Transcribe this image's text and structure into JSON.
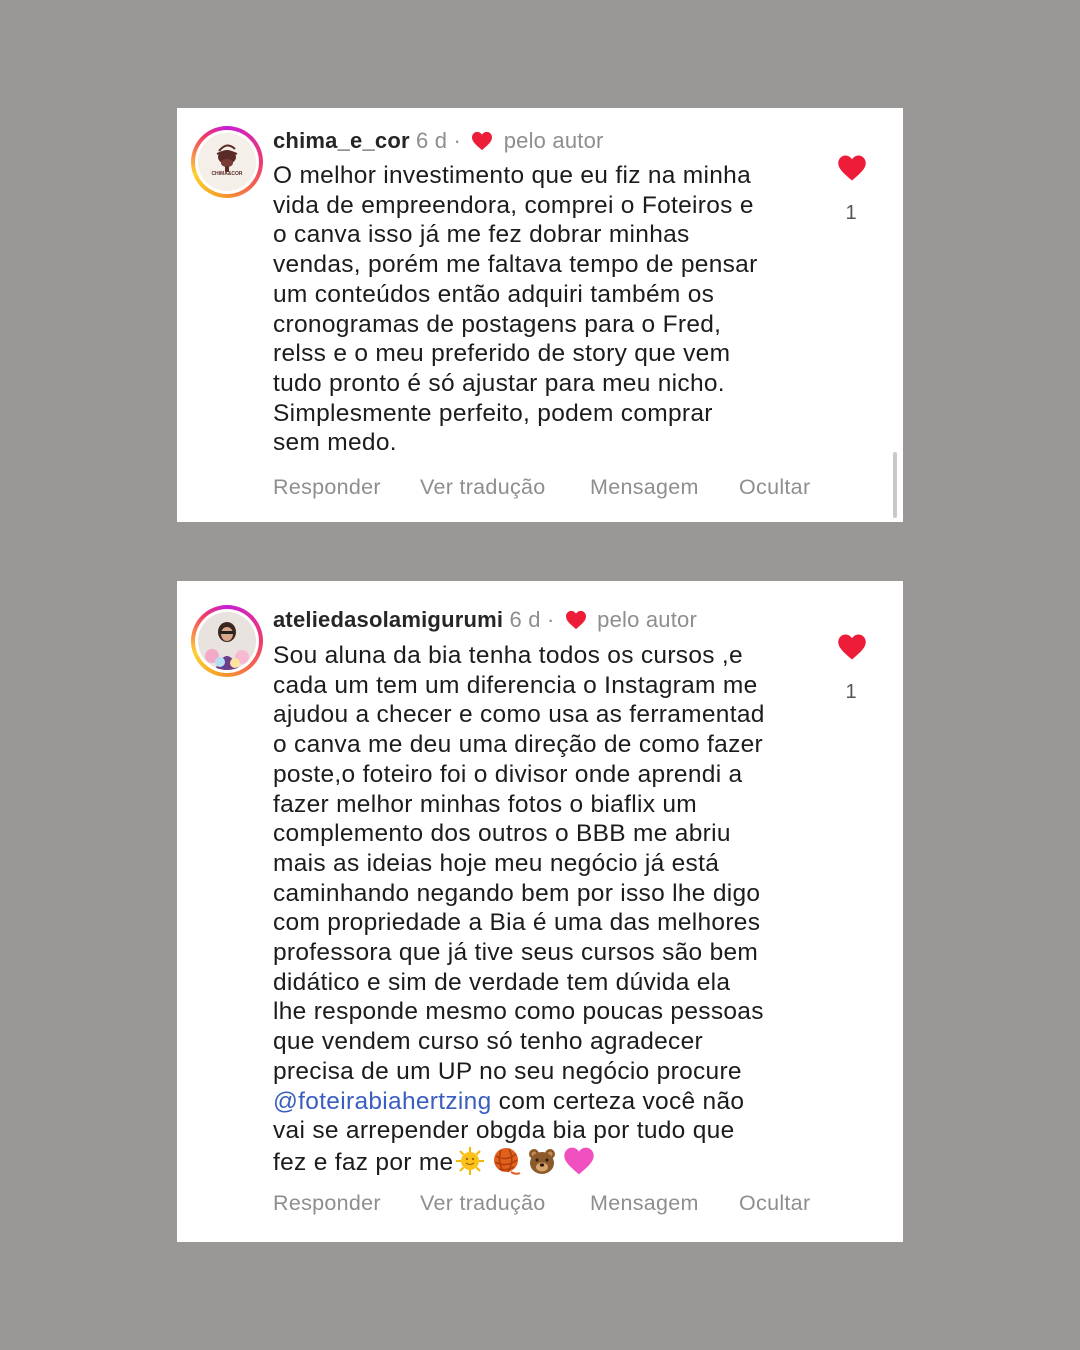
{
  "comments": [
    {
      "username": "chima_e_cor",
      "time": "6 d",
      "separator": "·",
      "liked_by_author_label": "pelo autor",
      "lines": [
        "O melhor investimento que eu fiz na minha",
        "vida de empreendora, comprei o Foteiros e",
        "o canva isso já me fez dobrar minhas",
        "vendas, porém me faltava tempo de pensar",
        "um conteúdos então adquiri também os",
        "cronogramas de postagens para o Fred,",
        "relss e o meu preferido de story que vem",
        "tudo pronto é só ajustar para meu nicho.",
        "Simplesmente perfeito, podem comprar",
        "sem medo."
      ],
      "like_count": "1",
      "avatar_label": "CHIMA&COR",
      "actions": {
        "reply": "Responder",
        "translate": "Ver tradução",
        "message": "Mensagem",
        "hide": "Ocultar"
      }
    },
    {
      "username": "ateliedasolamigurumi",
      "time": "6 d",
      "separator": "·",
      "liked_by_author_label": "pelo autor",
      "lines": [
        "Sou aluna da bia tenha todos os cursos ,e",
        "cada um tem um diferencia o Instagram me",
        "ajudou a checer e como usa as ferramentad",
        "o canva me deu uma direção de como fazer",
        "poste,o foteiro foi o divisor onde aprendi a",
        "fazer melhor minhas fotos o biaflix um",
        "complemento dos outros o BBB  me abriu",
        "mais as ideias hoje meu negócio já está",
        "caminhando negando bem por isso lhe digo",
        "com propriedade a Bia é uma das melhores",
        "professora que já tive seus cursos são bem",
        "didático e sim de verdade tem dúvida ela",
        "lhe responde mesmo como poucas pessoas",
        "que vendem curso  só tenho agradecer",
        "precisa de um UP no seu negócio procure"
      ],
      "mention": "@foteirabiahertzing",
      "mention_rest": " com certeza você não",
      "line_after_mention": "vai se arrepender obgda bia por tudo que",
      "last_line_text": "fez e faz por me",
      "emojis": [
        "sun-emoji",
        "yarn-ball-emoji",
        "bear-emoji",
        "pink-heart-emoji"
      ],
      "like_count": "1",
      "actions": {
        "reply": "Responder",
        "translate": "Ver tradução",
        "message": "Mensagem",
        "hide": "Ocultar"
      }
    }
  ],
  "colors": {
    "background": "#9a9797",
    "card": "#ffffff",
    "heart": "#ed1c38",
    "muted_text": "#8e8e8e",
    "mention": "#3b5fc0"
  }
}
